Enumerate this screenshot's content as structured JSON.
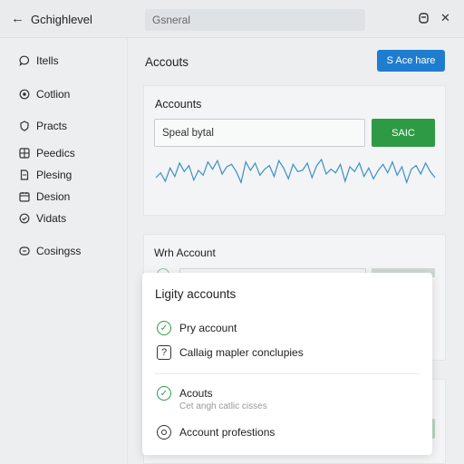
{
  "header": {
    "title": "Gchighlevel",
    "search_text": "Gsneral"
  },
  "sidebar": {
    "items": [
      {
        "label": "Itells",
        "icon": "chat-bubble-icon"
      },
      {
        "label": "Cotlion",
        "icon": "circle-dot-icon"
      },
      {
        "label": "Practs",
        "icon": "shield-icon"
      },
      {
        "label": "Peedics",
        "icon": "grid-icon"
      },
      {
        "label": "Plesing",
        "icon": "document-icon"
      },
      {
        "label": "Desion",
        "icon": "calendar-icon"
      },
      {
        "label": "Vidats",
        "icon": "check-circle-icon"
      },
      {
        "label": "Cosingss",
        "icon": "chat-minus-icon"
      }
    ]
  },
  "main": {
    "page_title": "Accouts",
    "primary_button": "S Ace hare",
    "card": {
      "title": "Accounts",
      "input_value": "Speal bytal",
      "action_button": "SAIC"
    },
    "section2_title": "Wrh Account"
  },
  "modal": {
    "title": "Ligity accounts",
    "options": [
      {
        "label": "Pry account",
        "sub": "",
        "icon": "check-circle-icon"
      },
      {
        "label": "Callaig mapler conclupies",
        "sub": "",
        "icon": "question-icon"
      },
      {
        "label": "Acouts",
        "sub": "Cet angh catlic cisses",
        "icon": "check-circle-icon"
      },
      {
        "label": "Account profestions",
        "sub": "",
        "icon": "circle-outline-icon"
      }
    ]
  },
  "colors": {
    "accent_blue": "#1f7dd0",
    "accent_green": "#2f9a45",
    "wave_line": "#3d8fc4"
  },
  "wave": [
    12,
    16,
    9,
    20,
    13,
    24,
    17,
    22,
    10,
    18,
    14,
    25,
    19,
    26,
    15,
    21,
    23,
    17,
    8,
    25,
    18,
    24,
    14,
    19,
    22,
    13,
    26,
    20,
    11,
    23,
    17,
    18,
    24,
    12,
    22,
    27,
    15,
    19,
    16,
    23,
    9,
    21,
    17,
    24,
    13,
    20,
    11,
    18,
    23,
    16,
    25,
    14,
    21,
    8,
    19,
    22,
    15,
    24,
    17,
    12
  ]
}
